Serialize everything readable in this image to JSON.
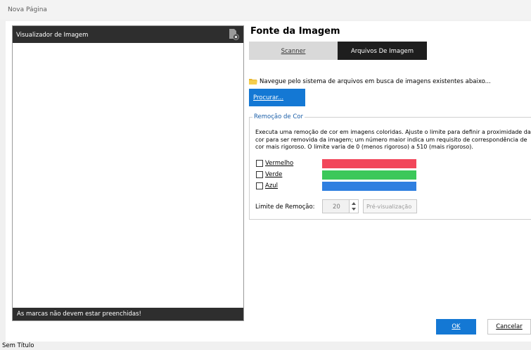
{
  "window": {
    "title": "Nova Página"
  },
  "viewer": {
    "header": "Visualizador de Imagem",
    "footer": "As marcas não devem estar preenchidas!"
  },
  "source": {
    "heading": "Fonte da Imagem",
    "tabs": [
      {
        "label": "Scanner",
        "active": false
      },
      {
        "label": "Arquivos De Imagem",
        "active": true
      }
    ],
    "browse_hint": "Navegue pelo sistema de arquivos em busca de imagens existentes abaixo...",
    "browse_button": "Procurar..."
  },
  "color_removal": {
    "legend": "Remoção de Cor",
    "description": "Executa uma remoção de cor em imagens coloridas. Ajuste o limite para definir a proximidade da cor para ser removida da imagem; um número maior indica um requisito de correspondência de cor mais rigoroso. O limite varia de 0 (menos rigoroso) a 510 (mais rigoroso).",
    "colors": [
      {
        "label": "Vermelho",
        "checked": false,
        "swatch": "#f2465a"
      },
      {
        "label": "Verde",
        "checked": false,
        "swatch": "#3cc85a"
      },
      {
        "label": "Azul",
        "checked": false,
        "swatch": "#2f7fe0"
      }
    ],
    "limit_label": "Limite de Remoção:",
    "limit_value": "20",
    "preview_button": "Pré-visualização"
  },
  "dialog": {
    "ok": "OK",
    "cancel": "Cancelar"
  },
  "status": {
    "text": "Sem Título"
  }
}
